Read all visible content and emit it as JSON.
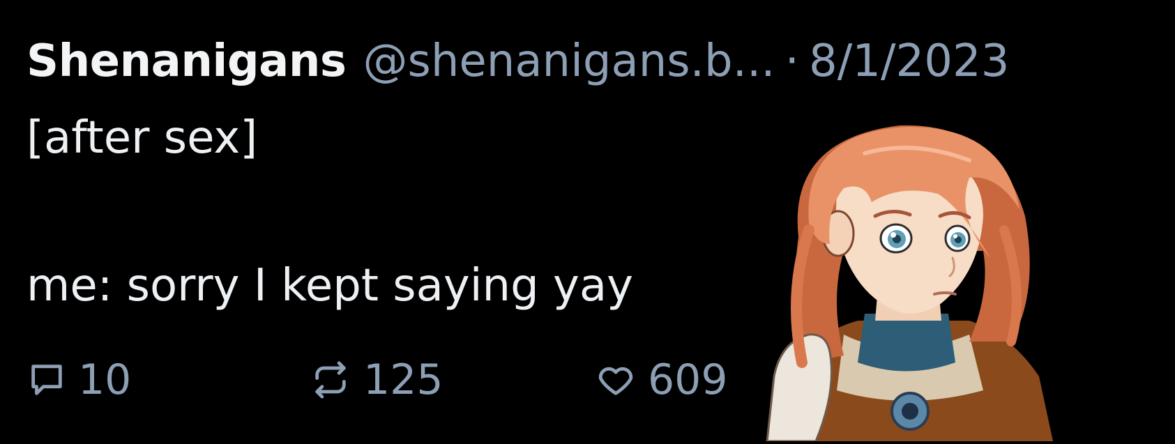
{
  "post": {
    "display_name": "Shenanigans",
    "handle": "@shenanigans.b...",
    "separator": "·",
    "date": "8/1/2023",
    "text_line1": "[after sex]",
    "text_line2": "me: sorry I kept saying yay"
  },
  "actions": {
    "reply": {
      "icon": "comment-icon",
      "count": "10"
    },
    "repost": {
      "icon": "repost-icon",
      "count": "125"
    },
    "like": {
      "icon": "heart-icon",
      "count": "609"
    }
  },
  "colors": {
    "background": "#000000",
    "primary_text": "#f2f4f6",
    "secondary_text": "#8d9fb5",
    "hair": "#e8956a",
    "eyes": "#5fa0b8"
  }
}
